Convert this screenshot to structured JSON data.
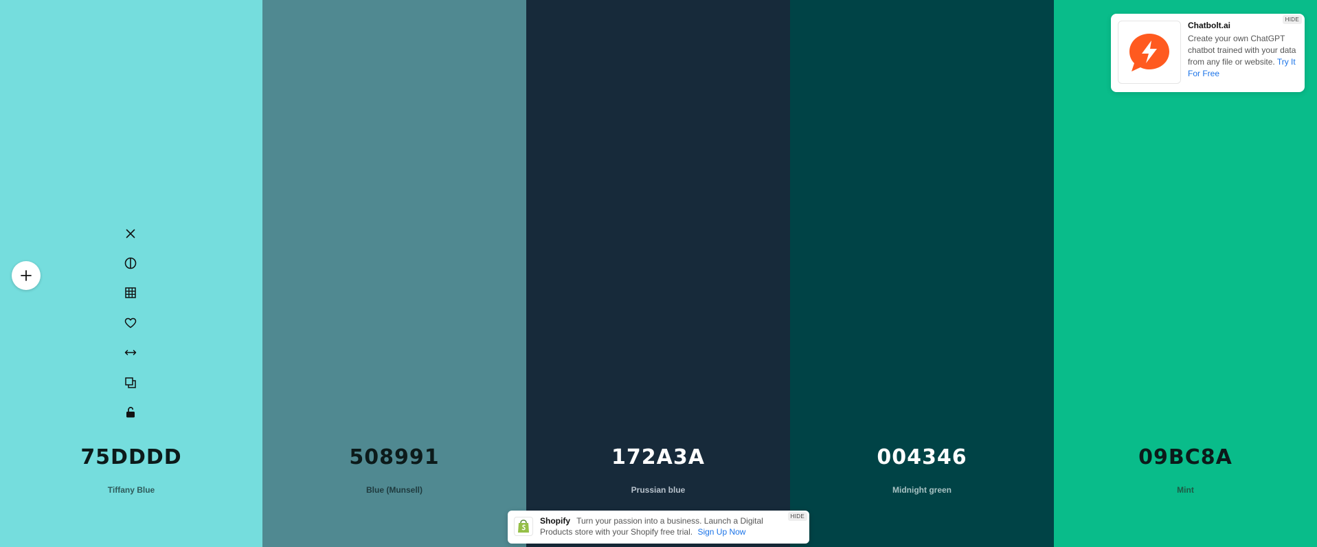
{
  "colors": [
    {
      "hex": "75DDDD",
      "name": "Tiffany Blue",
      "bg": "#75DDDD",
      "hex_color": "#0c1a1a",
      "name_color": "#2f5a5a"
    },
    {
      "hex": "508991",
      "name": "Blue (Munsell)",
      "bg": "#508991",
      "hex_color": "#0c1a1a",
      "name_color": "#1f3a3e"
    },
    {
      "hex": "172A3A",
      "name": "Prussian blue",
      "bg": "#172A3A",
      "hex_color": "#ffffff",
      "name_color": "#b8c2cc"
    },
    {
      "hex": "004346",
      "name": "Midnight green",
      "bg": "#004346",
      "hex_color": "#ffffff",
      "name_color": "#a8c2c3"
    },
    {
      "hex": "09BC8A",
      "name": "Mint",
      "bg": "#09BC8A",
      "hex_color": "#0c1a1a",
      "name_color": "#1e5a45"
    }
  ],
  "toolbar": [
    {
      "name": "close-icon"
    },
    {
      "name": "contrast-icon"
    },
    {
      "name": "grid-icon"
    },
    {
      "name": "heart-icon"
    },
    {
      "name": "drag-horizontal-icon"
    },
    {
      "name": "copy-icon"
    },
    {
      "name": "unlock-icon"
    }
  ],
  "ad": {
    "title": "Chatbolt.ai",
    "text": "Create your own ChatGPT chatbot trained with your data from any file or website.",
    "link": "Try It For Free",
    "hide": "HIDE",
    "accent": "#FF5A1F"
  },
  "banner": {
    "brand": "Shopify",
    "text": "Turn your passion into a business. Launch a Digital Products store with your Shopify free trial.",
    "link": "Sign Up Now",
    "hide": "HIDE",
    "accent": "#95BF47"
  }
}
